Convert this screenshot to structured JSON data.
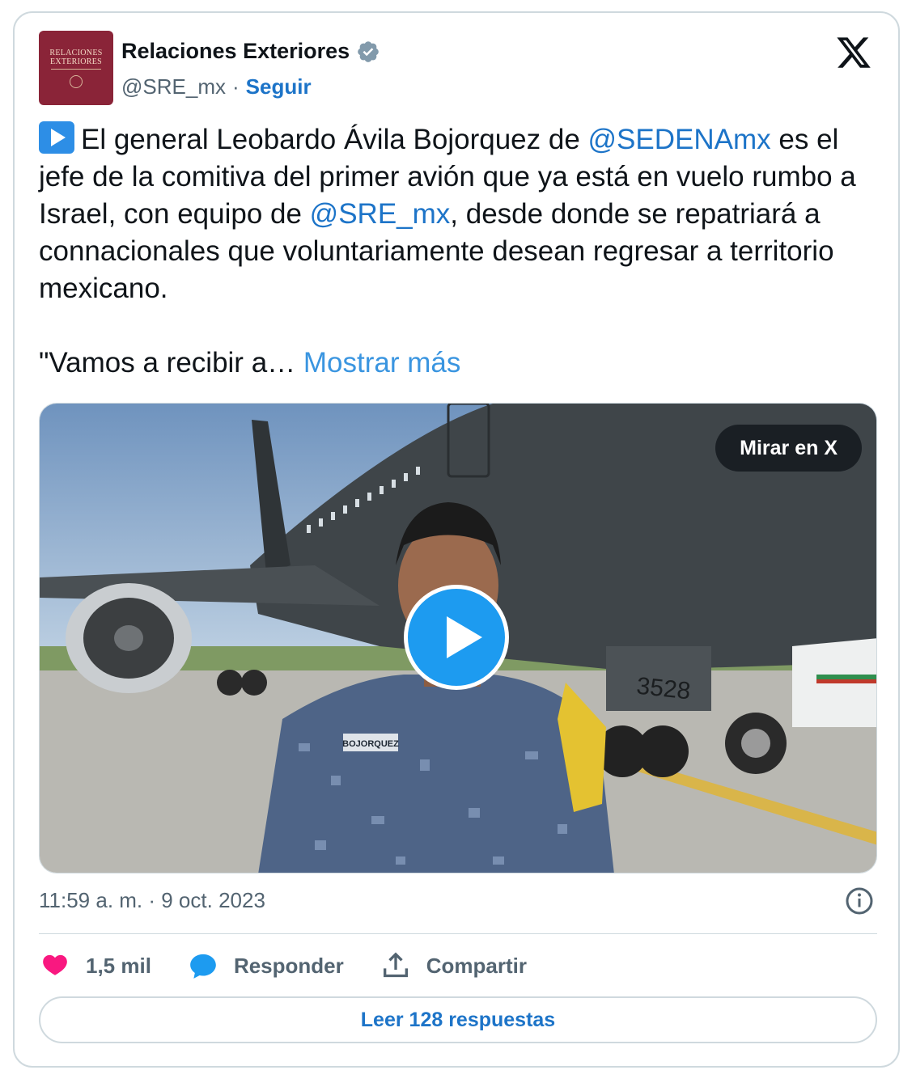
{
  "account": {
    "avatar_line1": "RELACIONES",
    "avatar_line2": "EXTERIORES",
    "name": "Relaciones Exteriores",
    "handle": "@SRE_mx",
    "separator": "·",
    "follow_label": "Seguir"
  },
  "tweet": {
    "text_before_mention1": "El general Leobardo Ávila Bojorquez de ",
    "mention1": "@SEDENAmx",
    "text_after_mention1": " es el jefe de la comitiva del primer avión que ya está en vuelo rumbo a Israel, con equipo de ",
    "mention2": "@SRE_mx",
    "text_after_mention2": ", desde donde se repatriará a connacionales que voluntariamente desean regresar a territorio mexicano.",
    "second_paragraph": "\"Vamos a recibir a…",
    "show_more": "Mostrar más"
  },
  "media": {
    "watch_label": "Mirar en X",
    "plane_number": "3528",
    "name_tag": "BOJORQUEZ"
  },
  "meta": {
    "timestamp": "11:59 a. m. · 9 oct. 2023"
  },
  "actions": {
    "likes": "1,5 mil",
    "reply_label": "Responder",
    "share_label": "Compartir"
  },
  "read_replies": "Leer 128 respuestas",
  "colors": {
    "accent": "#1d9bf0",
    "link": "#1d74c8",
    "like": "#f91880",
    "avatar_bg": "#8a2438"
  },
  "icons": [
    "verified-badge-icon",
    "x-logo-icon",
    "play-icon",
    "info-icon",
    "heart-icon",
    "reply-icon",
    "share-icon"
  ]
}
